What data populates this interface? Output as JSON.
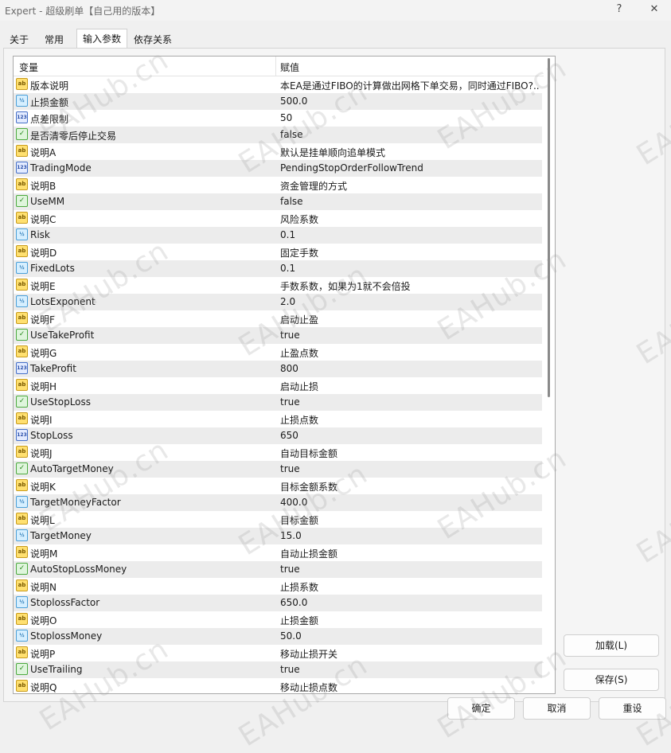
{
  "window": {
    "title": "Expert - 超级刷单【自己用的版本】",
    "help_label": "?",
    "close_label": "✕"
  },
  "tabs": [
    {
      "label": "关于",
      "active": false
    },
    {
      "label": "常用",
      "active": false
    },
    {
      "label": "输入参数",
      "active": true
    },
    {
      "label": "依存关系",
      "active": false
    }
  ],
  "grid": {
    "col_variable": "变量",
    "col_value": "赋值",
    "rows": [
      {
        "icon": "string-icon",
        "name": "版本说明",
        "value": "本EA是通过FIBO的计算做出网格下单交易，同时通过FIBO?.."
      },
      {
        "icon": "double-icon",
        "name": "止损金额",
        "value": "500.0"
      },
      {
        "icon": "integer-icon",
        "name": "点差限制",
        "value": "50"
      },
      {
        "icon": "bool-icon",
        "name": "是否清零后停止交易",
        "value": "false"
      },
      {
        "icon": "string-icon",
        "name": "说明A",
        "value": "默认是挂单顺向追单模式"
      },
      {
        "icon": "integer-icon",
        "name": "TradingMode",
        "value": "PendingStopOrderFollowTrend"
      },
      {
        "icon": "string-icon",
        "name": "说明B",
        "value": "资金管理的方式"
      },
      {
        "icon": "bool-icon",
        "name": "UseMM",
        "value": "false"
      },
      {
        "icon": "string-icon",
        "name": "说明C",
        "value": "风险系数"
      },
      {
        "icon": "double-icon",
        "name": "Risk",
        "value": "0.1"
      },
      {
        "icon": "string-icon",
        "name": "说明D",
        "value": "固定手数"
      },
      {
        "icon": "double-icon",
        "name": "FixedLots",
        "value": "0.1"
      },
      {
        "icon": "string-icon",
        "name": "说明E",
        "value": "手数系数，如果为1就不会倍投"
      },
      {
        "icon": "double-icon",
        "name": "LotsExponent",
        "value": "2.0"
      },
      {
        "icon": "string-icon",
        "name": "说明F",
        "value": "启动止盈"
      },
      {
        "icon": "bool-icon",
        "name": "UseTakeProfit",
        "value": "true"
      },
      {
        "icon": "string-icon",
        "name": "说明G",
        "value": "止盈点数"
      },
      {
        "icon": "integer-icon",
        "name": "TakeProfit",
        "value": "800"
      },
      {
        "icon": "string-icon",
        "name": "说明H",
        "value": "启动止损"
      },
      {
        "icon": "bool-icon",
        "name": "UseStopLoss",
        "value": "true"
      },
      {
        "icon": "string-icon",
        "name": "说明I",
        "value": "止损点数"
      },
      {
        "icon": "integer-icon",
        "name": "StopLoss",
        "value": "650"
      },
      {
        "icon": "string-icon",
        "name": "说明J",
        "value": "自动目标金额"
      },
      {
        "icon": "bool-icon",
        "name": "AutoTargetMoney",
        "value": "true"
      },
      {
        "icon": "string-icon",
        "name": "说明K",
        "value": "目标金额系数"
      },
      {
        "icon": "double-icon",
        "name": "TargetMoneyFactor",
        "value": "400.0"
      },
      {
        "icon": "string-icon",
        "name": "说明L",
        "value": "目标金额"
      },
      {
        "icon": "double-icon",
        "name": "TargetMoney",
        "value": "15.0"
      },
      {
        "icon": "string-icon",
        "name": "说明M",
        "value": "自动止损金额"
      },
      {
        "icon": "bool-icon",
        "name": "AutoStopLossMoney",
        "value": "true"
      },
      {
        "icon": "string-icon",
        "name": "说明N",
        "value": "止损系数"
      },
      {
        "icon": "double-icon",
        "name": "StoplossFactor",
        "value": "650.0"
      },
      {
        "icon": "string-icon",
        "name": "说明O",
        "value": "止损金额"
      },
      {
        "icon": "double-icon",
        "name": "StoplossMoney",
        "value": "50.0"
      },
      {
        "icon": "string-icon",
        "name": "说明P",
        "value": "移动止损开关"
      },
      {
        "icon": "bool-icon",
        "name": "UseTrailing",
        "value": "true"
      },
      {
        "icon": "string-icon",
        "name": "说明Q",
        "value": "移动止损点数"
      }
    ]
  },
  "icon_glyphs": {
    "string-icon": "ab",
    "double-icon": "½",
    "integer-icon": "123",
    "bool-icon": "✓"
  },
  "buttons": {
    "load": "加载(L)",
    "save": "保存(S)",
    "ok": "确定",
    "cancel": "取消",
    "reset": "重设"
  },
  "watermark_text": "EAHub.cn"
}
